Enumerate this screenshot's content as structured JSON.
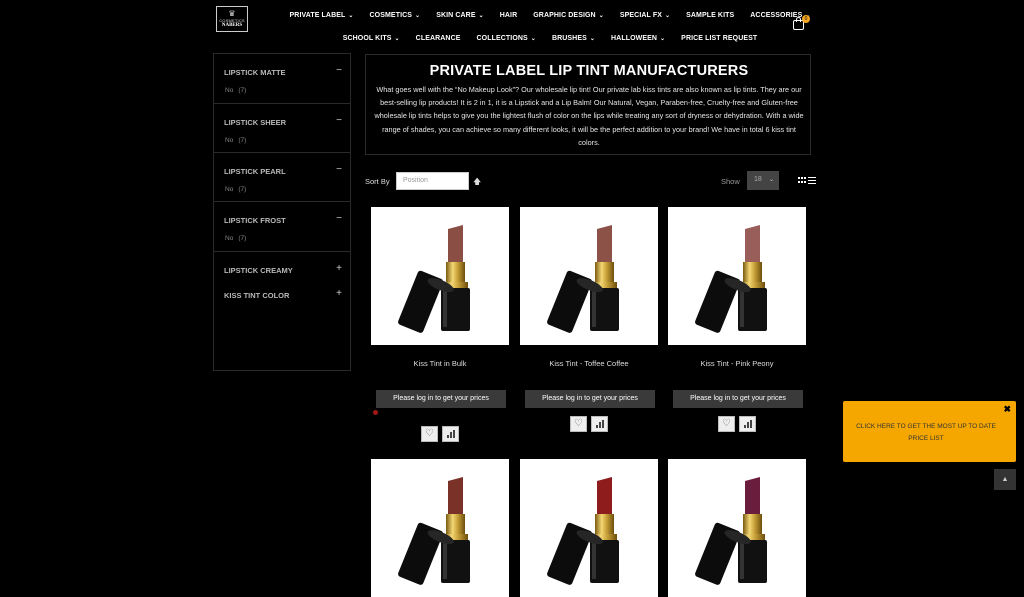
{
  "brand": {
    "logo_text_top": "COSMETICS",
    "logo_text_bottom": "NABERS"
  },
  "nav": {
    "row1": [
      {
        "label": "PRIVATE LABEL",
        "dropdown": true
      },
      {
        "label": "COSMETICS",
        "dropdown": true
      },
      {
        "label": "SKIN CARE",
        "dropdown": true
      },
      {
        "label": "HAIR",
        "dropdown": false
      },
      {
        "label": "GRAPHIC DESIGN",
        "dropdown": true
      },
      {
        "label": "SPECIAL FX",
        "dropdown": true
      },
      {
        "label": "SAMPLE KITS",
        "dropdown": false
      },
      {
        "label": "ACCESSORIES",
        "dropdown": true
      }
    ],
    "row2": [
      {
        "label": "SCHOOL KITS",
        "dropdown": true
      },
      {
        "label": "CLEARANCE",
        "dropdown": false
      },
      {
        "label": "COLLECTIONS",
        "dropdown": true
      },
      {
        "label": "BRUSHES",
        "dropdown": true
      },
      {
        "label": "HALLOWEEN",
        "dropdown": true
      },
      {
        "label": "PRICE LIST REQUEST",
        "dropdown": false
      }
    ],
    "chevron": "⌄",
    "cart_count": "0"
  },
  "filters": [
    {
      "title": "LIPSTICK MATTE",
      "sign": "−",
      "option": "No",
      "count": "(7)"
    },
    {
      "title": "LIPSTICK SHEER",
      "sign": "−",
      "option": "No",
      "count": "(7)"
    },
    {
      "title": "LIPSTICK PEARL",
      "sign": "−",
      "option": "No",
      "count": "(7)"
    },
    {
      "title": "LIPSTICK FROST",
      "sign": "−",
      "option": "No",
      "count": "(7)"
    },
    {
      "title": "LIPSTICK CREAMY",
      "sign": "+"
    },
    {
      "title": "KISS TINT COLOR",
      "sign": "+"
    }
  ],
  "category": {
    "title": "PRIVATE LABEL LIP TINT MANUFACTURERS",
    "description": "What goes well with the “No Makeup Look”? Our wholesale lip tint! Our private lab kiss tints are also known as lip tints. They are our best-selling lip products! It is 2 in 1, it is a Lipstick and a Lip Balm! Our Natural, Vegan, Paraben-free, Cruelty-free and Gluten-free wholesale lip tints helps to give you the lightest flush of color on the lips while treating any sort of dryness or dehydration. With a wide range of shades, you can achieve so many different looks, it will be the perfect addition to your brand! We have in total 6 kiss tint colors."
  },
  "toolbar": {
    "sort_label": "Sort By",
    "sort_value": "Position",
    "sort_arrow": "🡅",
    "show_label": "Show",
    "show_value": "18",
    "show_chevron": "⌄"
  },
  "products": [
    {
      "name": "Kiss Tint in Bulk",
      "button": "Please log in to get your prices",
      "bullet_color": "#8a4e45"
    },
    {
      "name": "Kiss Tint - Toffee Coffee",
      "button": "Please log in to get your prices",
      "bullet_color": "#8c5247"
    },
    {
      "name": "Kiss Tint - Pink Peony",
      "button": "Please log in to get your prices",
      "bullet_color": "#9a5e5a"
    }
  ],
  "products_row2": [
    {
      "bullet_color": "#7a3228"
    },
    {
      "bullet_color": "#8e1c1c"
    },
    {
      "bullet_color": "#6b1d3e"
    }
  ],
  "popup": {
    "text": "CLICK HERE TO GET THE MOST UP TO DATE PRICE LIST",
    "close": "✖"
  },
  "back_to_top": "▲",
  "colors": {
    "accent": "#f5a700",
    "background": "#000000",
    "button": "#3a3a3a"
  }
}
